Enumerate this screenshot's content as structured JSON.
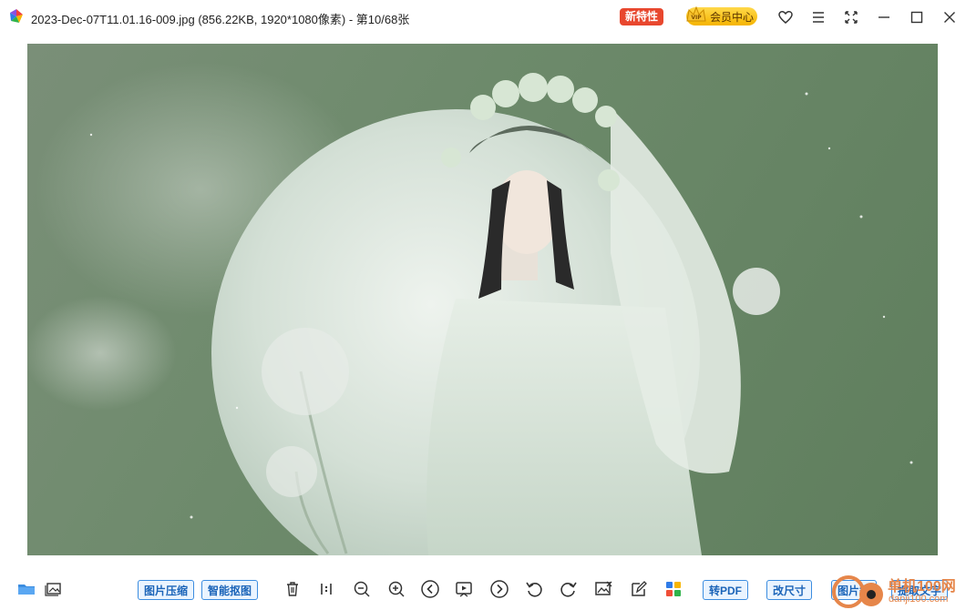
{
  "window": {
    "title": "2023-Dec-07T11.01.16-009.jpg (856.22KB, 1920*1080像素) - 第10/68张",
    "new_features_label": "新特性",
    "vip_label": "会员中心",
    "vip_crown_text": "VIP",
    "controls": [
      "heart-icon",
      "menu-icon",
      "fullscreen-icon",
      "minimize-icon",
      "maximize-icon",
      "close-icon"
    ]
  },
  "toolbar": {
    "compress_label": "图片压缩",
    "cutout_label": "智能抠图",
    "to_pdf_label": "转PDF",
    "resize_label": "改尺寸",
    "translate_label": "图片翻",
    "extract_text_label": "提取文字"
  },
  "watermark": {
    "line1": "单机100网",
    "line2": "danji100.com"
  },
  "colors": {
    "accent": "#3c8de0",
    "new_badge": "#e8472e",
    "vip_gold": "#f5b400",
    "photo_green": "#6d8a6b"
  }
}
